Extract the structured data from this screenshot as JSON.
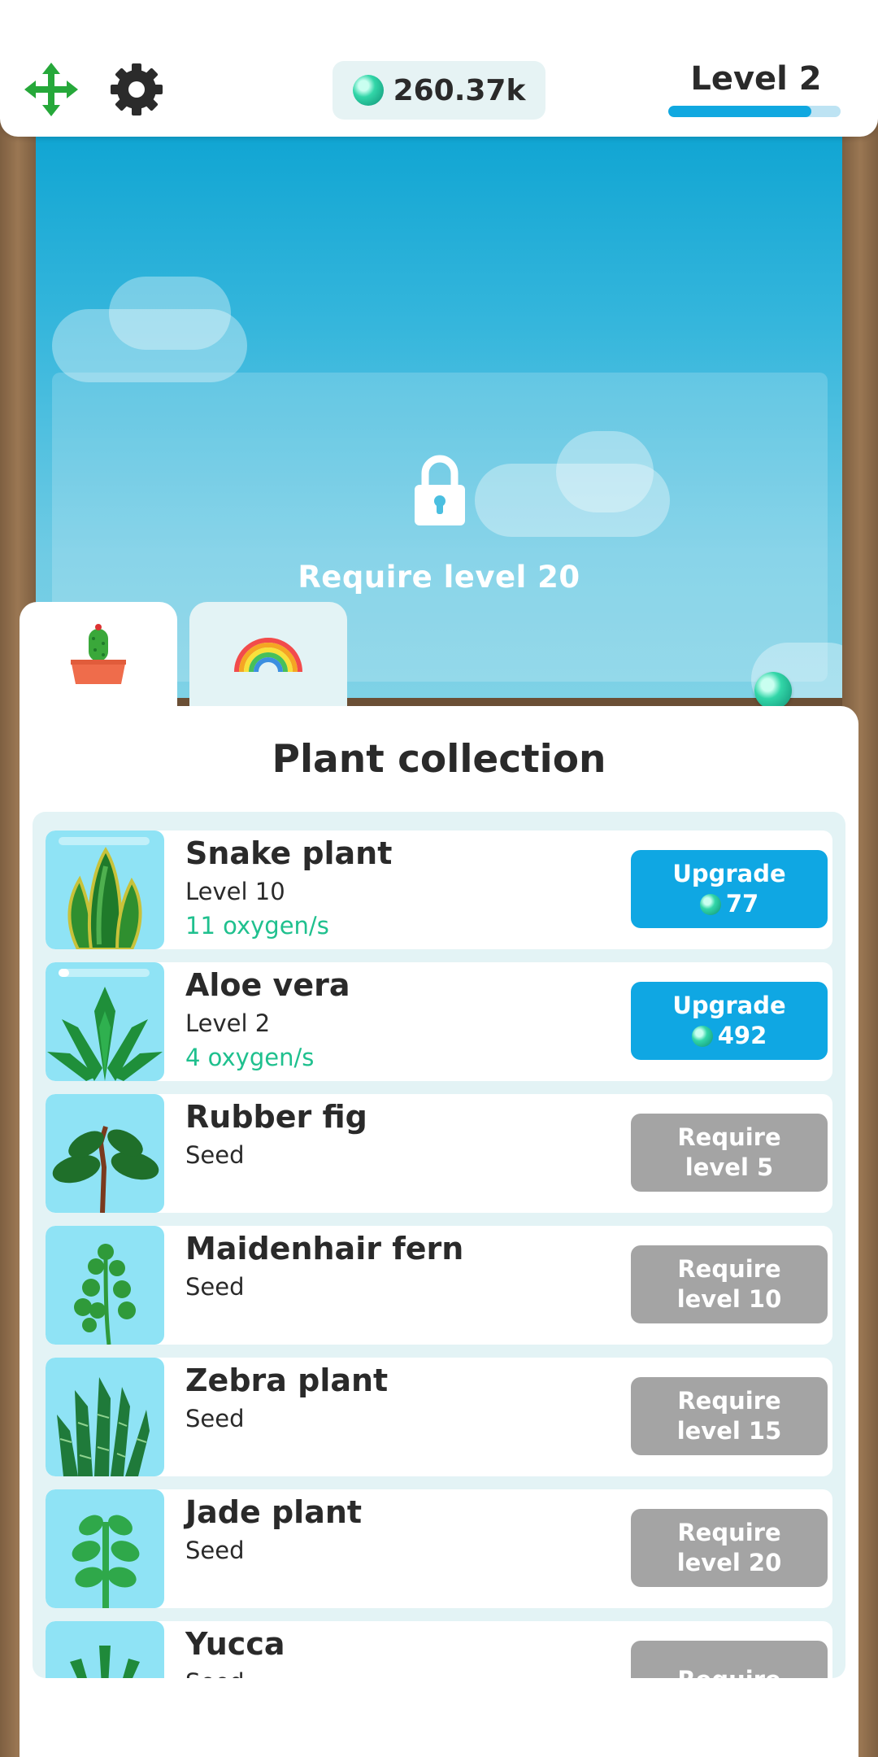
{
  "hud": {
    "currency_amount": "260.37k",
    "level_label": "Level 2",
    "xp_progress": 0.83
  },
  "garden": {
    "lock_text": "Require level 20"
  },
  "tabs": [
    {
      "name": "plants",
      "icon": "cactus-pot-icon"
    },
    {
      "name": "decorations",
      "icon": "rainbow-icon"
    }
  ],
  "panel": {
    "title": "Plant collection"
  },
  "plants": [
    {
      "name": "Snake plant",
      "level": "Level 10",
      "rate": "11 oxygen/s",
      "action_label": "Upgrade",
      "cost": "77",
      "growth": 0.0
    },
    {
      "name": "Aloe vera",
      "level": "Level 2",
      "rate": "4 oxygen/s",
      "action_label": "Upgrade",
      "cost": "492",
      "growth": 0.12
    },
    {
      "name": "Rubber fig",
      "level": "Seed",
      "action_label": "Require\nlevel 5"
    },
    {
      "name": "Maidenhair fern",
      "level": "Seed",
      "action_label": "Require\nlevel 10"
    },
    {
      "name": "Zebra plant",
      "level": "Seed",
      "action_label": "Require\nlevel 15"
    },
    {
      "name": "Jade plant",
      "level": "Seed",
      "action_label": "Require\nlevel 20"
    },
    {
      "name": "Yucca",
      "level": "Seed",
      "action_label": "Require"
    }
  ],
  "colors": {
    "accent": "#0fa7e3",
    "oxygen_green": "#1fc08e",
    "locked_gray": "#a4a4a4"
  }
}
